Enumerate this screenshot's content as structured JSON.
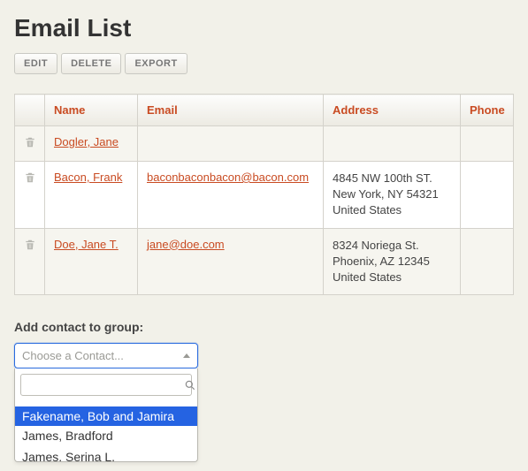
{
  "page_title": "Email List",
  "toolbar": {
    "edit": "EDIT",
    "delete": "DELETE",
    "export": "EXPORT"
  },
  "columns": {
    "name": "Name",
    "email": "Email",
    "address": "Address",
    "phone": "Phone"
  },
  "rows": [
    {
      "name": "Dogler, Jane",
      "email": "",
      "address_lines": [
        "",
        "",
        ""
      ],
      "phone": ""
    },
    {
      "name": "Bacon, Frank",
      "email": "baconbaconbacon@bacon.com",
      "address_lines": [
        "4845 NW 100th ST.",
        "New York, NY 54321",
        "United States"
      ],
      "phone": ""
    },
    {
      "name": "Doe, Jane T.",
      "email": "jane@doe.com",
      "address_lines": [
        "8324 Noriega St.",
        "Phoenix, AZ 12345",
        "United States"
      ],
      "phone": ""
    }
  ],
  "add_contact_label": "Add contact to group:",
  "contact_select": {
    "placeholder": "Choose a Contact...",
    "search_value": "",
    "options": [
      {
        "label": "Fakename, Bob and Jamira",
        "selected": true
      },
      {
        "label": "James, Bradford",
        "selected": false
      },
      {
        "label": "James, Serina L.",
        "selected": false
      }
    ]
  }
}
